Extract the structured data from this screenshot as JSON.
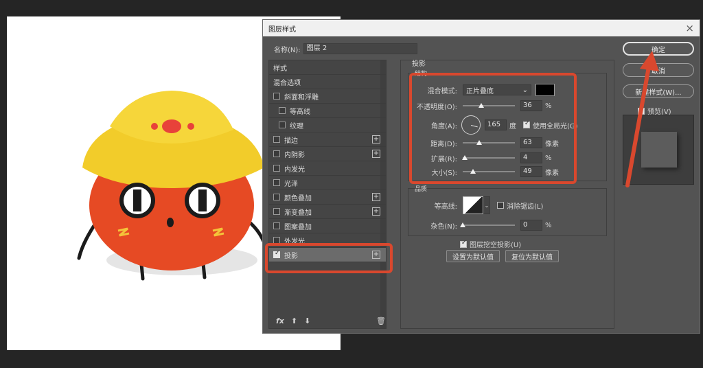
{
  "dialog": {
    "title": "图层样式",
    "name_label": "名称(N):",
    "name_value": "图层 2"
  },
  "styles_list": {
    "header": "样式",
    "blend_options": "混合选项",
    "items": [
      {
        "label": "斜面和浮雕",
        "checked": false,
        "plus": false,
        "sub": false
      },
      {
        "label": "等高线",
        "checked": false,
        "plus": false,
        "sub": true
      },
      {
        "label": "纹理",
        "checked": false,
        "plus": false,
        "sub": true
      },
      {
        "label": "描边",
        "checked": false,
        "plus": true,
        "sub": false
      },
      {
        "label": "内阴影",
        "checked": false,
        "plus": true,
        "sub": false
      },
      {
        "label": "内发光",
        "checked": false,
        "plus": false,
        "sub": false
      },
      {
        "label": "光泽",
        "checked": false,
        "plus": false,
        "sub": false
      },
      {
        "label": "颜色叠加",
        "checked": false,
        "plus": true,
        "sub": false
      },
      {
        "label": "渐变叠加",
        "checked": false,
        "plus": true,
        "sub": false
      },
      {
        "label": "图案叠加",
        "checked": false,
        "plus": false,
        "sub": false
      },
      {
        "label": "外发光",
        "checked": false,
        "plus": false,
        "sub": false
      },
      {
        "label": "投影",
        "checked": true,
        "plus": true,
        "sub": false,
        "selected": true
      }
    ],
    "footer_fx": "fx"
  },
  "drop_shadow": {
    "section_title": "投影",
    "structure_title": "结构",
    "blend_mode_label": "混合模式:",
    "blend_mode_value": "正片叠底",
    "shadow_color": "#000000",
    "opacity_label": "不透明度(O):",
    "opacity_value": "36",
    "opacity_unit": "%",
    "angle_label": "角度(A):",
    "angle_value": "165",
    "angle_unit": "度",
    "global_light_label": "使用全局光(G)",
    "distance_label": "距离(D):",
    "distance_value": "63",
    "distance_unit": "像素",
    "spread_label": "扩展(R):",
    "spread_value": "4",
    "spread_unit": "%",
    "size_label": "大小(S):",
    "size_value": "49",
    "size_unit": "像素",
    "quality_title": "品质",
    "contour_label": "等高线:",
    "antialias_label": "消除锯齿(L)",
    "noise_label": "杂色(N):",
    "noise_value": "0",
    "noise_unit": "%",
    "knockout_label": "图层挖空投影(U)",
    "set_default": "设置为默认值",
    "reset_default": "复位为默认值"
  },
  "actions": {
    "ok": "确定",
    "cancel": "取消",
    "new_style": "新建样式(W)...",
    "preview": "预览(V)"
  },
  "sliders": {
    "opacity": 0.36,
    "distance": 0.32,
    "spread": 0.04,
    "size": 0.2,
    "noise": 0.0
  },
  "colors": {
    "highlight": "#d9482e",
    "dialog_bg": "#535353"
  }
}
